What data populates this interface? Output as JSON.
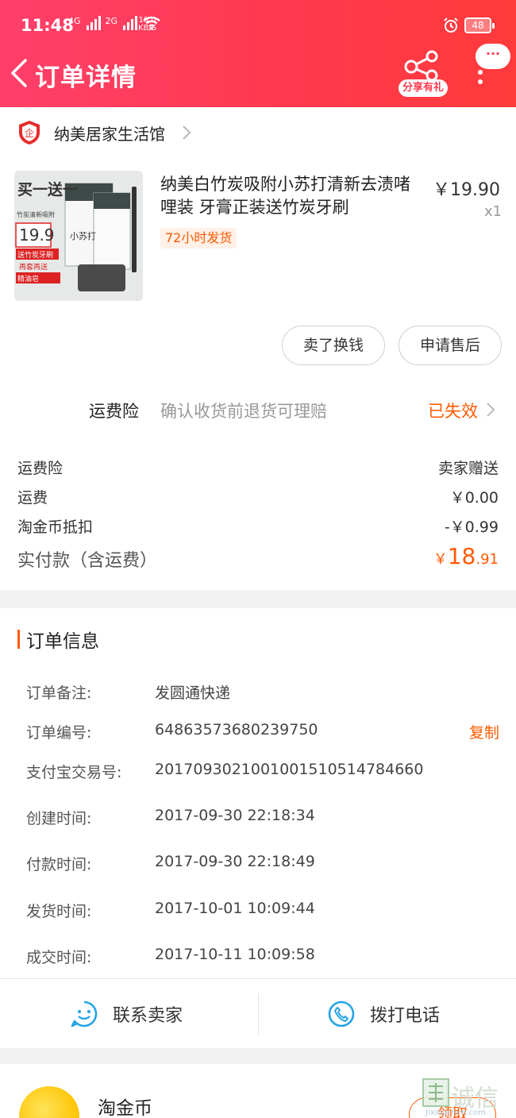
{
  "status_bar": {
    "time": "11:48",
    "signal1": "4G",
    "signal2": "2G",
    "speed_value": "10.0",
    "speed_unit": "KB/S",
    "battery": "48"
  },
  "header": {
    "title": "订单详情",
    "share_label": "分享有礼",
    "more_bubble": "···"
  },
  "shop": {
    "name": "纳美居家生活馆",
    "badge_text": "企"
  },
  "product": {
    "title": "纳美白竹炭吸附小苏打清新去渍啫哩装 牙膏正装送竹炭牙刷",
    "price": "￥19.90",
    "qty": "x1",
    "tag": "72小时发货",
    "image_texts": [
      "买一送一",
      "竹炭清新吸附",
      "19.9",
      "送竹炭牙刷",
      "再套再送",
      "精油皂",
      "小苏打"
    ]
  },
  "actions": {
    "resell": "卖了换钱",
    "after_sale": "申请售后"
  },
  "insurance": {
    "name": "运费险",
    "desc": "确认收货前退货可理赔",
    "status": "已失效"
  },
  "fees": [
    {
      "label": "运费险",
      "value": "卖家赠送"
    },
    {
      "label": "运费",
      "value": "￥0.00"
    },
    {
      "label": "淘金币抵扣",
      "value": "-￥0.99"
    }
  ],
  "total": {
    "label": "实付款（含运费）",
    "currency": "￥",
    "integer": "18",
    "decimal": ".91"
  },
  "order_info": {
    "title": "订单信息",
    "copy_label": "复制",
    "rows": [
      {
        "key": "订单备注:",
        "value": "发圆通快递"
      },
      {
        "key": "订单编号:",
        "value": "64863573680239750"
      },
      {
        "key": "支付宝交易号:",
        "value": "2017093021001001510514784660"
      },
      {
        "key": "创建时间:",
        "value": "2017-09-30 22:18:34"
      },
      {
        "key": "付款时间:",
        "value": "2017-09-30 22:18:49"
      },
      {
        "key": "发货时间:",
        "value": "2017-10-01 10:09:44"
      },
      {
        "key": "成交时间:",
        "value": "2017-10-11 10:09:58"
      }
    ]
  },
  "contact": {
    "seller": "联系卖家",
    "phone": "拨打电话"
  },
  "coins": {
    "label": "淘金币",
    "claim": "领取"
  },
  "watermark": {
    "text": "诚信",
    "url": "Jixingchen.com"
  },
  "colors": {
    "header_start": "#ff3f6a",
    "header_end": "#ff3a3a",
    "accent": "#ff5a00",
    "contact_icon": "#25a4e6"
  }
}
